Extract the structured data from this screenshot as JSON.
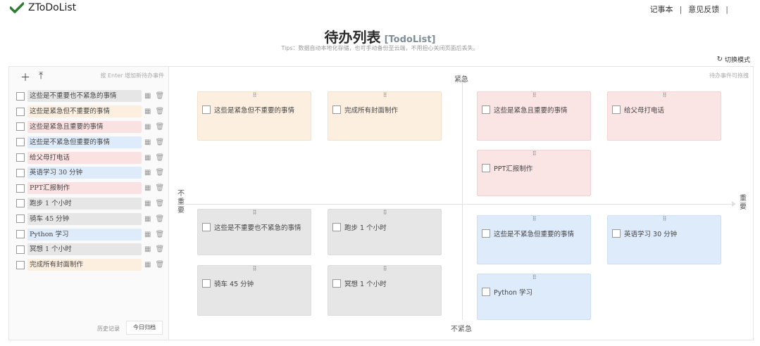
{
  "app": {
    "name": "ZToDoList"
  },
  "topnav": {
    "notebook": "记事本",
    "separator": "|",
    "feedback": "意见反馈",
    "tail_sep": "|"
  },
  "header": {
    "title": "待办列表",
    "subtitle": "[TodoList]",
    "tips": "Tips：数据自动本地化存储，也可手动备份至云端，不用担心关闭页面后丢失。",
    "switch_mode": "切换模式"
  },
  "sidebar": {
    "add_icon": "plus-icon",
    "upload_icon": "upload-icon",
    "hint": "按 Enter 增加新待办事件",
    "items": [
      {
        "label": "这些是不重要也不紧急的事情",
        "color": "grey"
      },
      {
        "label": "这些是紧急但不重要的事情",
        "color": "orange"
      },
      {
        "label": "这些是紧急且重要的事情",
        "color": "pink"
      },
      {
        "label": "这些是不紧急但重要的事情",
        "color": "blue"
      },
      {
        "label": "给父母打电话",
        "color": "pink"
      },
      {
        "label": "英语学习 30 分钟",
        "color": "blue"
      },
      {
        "label": "PPT汇报制作",
        "color": "pink"
      },
      {
        "label": "跑步 1 个小时",
        "color": "grey"
      },
      {
        "label": "骑车 45 分钟",
        "color": "grey"
      },
      {
        "label": "Python 学习",
        "color": "blue"
      },
      {
        "label": "冥想 1 个小时",
        "color": "grey"
      },
      {
        "label": "完成所有封面制作",
        "color": "orange"
      }
    ],
    "history": "历史记录",
    "archive_button": "今日归档"
  },
  "board": {
    "drag_hint": "待办事件可拖拽",
    "axis": {
      "urgent": "紧急",
      "not_urgent": "不紧急",
      "not_important": "不重要",
      "important": "重要"
    },
    "grip": "⠿",
    "quadrants": {
      "urgent_not_important": [
        "这些是紧急但不重要的事情",
        "完成所有封面制作"
      ],
      "urgent_important": [
        "这些是紧急且重要的事情",
        "给父母打电话",
        "PPT汇报制作"
      ],
      "not_urgent_not_important": [
        "这些是不重要也不紧急的事情",
        "跑步 1 个小时",
        "骑车 45 分钟",
        "冥想 1 个小时"
      ],
      "not_urgent_important": [
        "这些是不紧急但重要的事情",
        "英语学习 30 分钟",
        "Python 学习"
      ]
    }
  },
  "colors": {
    "grey": "#e6e6e6",
    "orange": "#fdefe0",
    "pink": "#fbe2e2",
    "blue": "#deebfa",
    "logo_green": "#2e7d32"
  }
}
